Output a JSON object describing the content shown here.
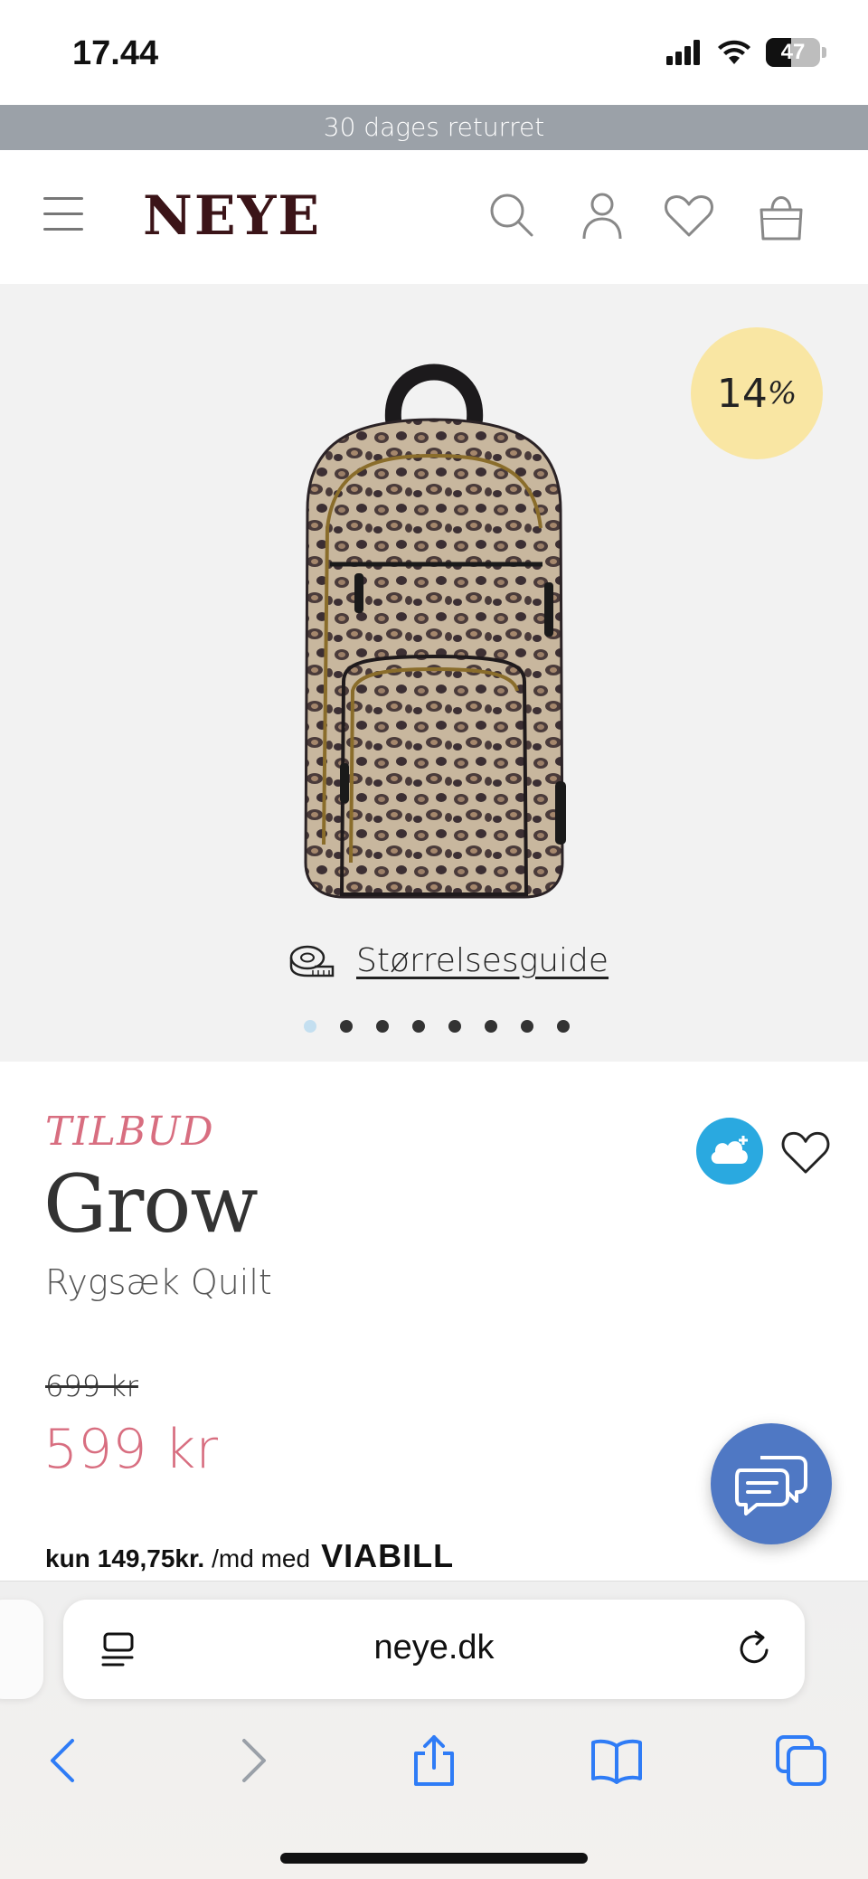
{
  "status_bar": {
    "time": "17.44",
    "battery_level": "47",
    "battery_fraction": 0.47
  },
  "promo": {
    "text": "30 dages returret"
  },
  "header": {
    "logo": "NEYE",
    "icons": [
      "menu-icon",
      "search-icon",
      "user-icon",
      "heart-icon",
      "shopping-bag-icon"
    ]
  },
  "gallery": {
    "discount": "14",
    "discount_symbol": "%",
    "size_guide_label": "Størrelsesguide",
    "dot_count": 8,
    "active_dot": 0
  },
  "product": {
    "tag": "TILBUD",
    "brand": "Grow",
    "name": "Rygsæk Quilt",
    "price_old": "699 kr",
    "price_new": "599 kr",
    "installment_prefix": "kun",
    "installment_amount": "149,75kr.",
    "installment_suffix": "/md med",
    "installment_provider": "VIABILL"
  },
  "browser": {
    "url": "neye.dk"
  },
  "colors": {
    "accent_pink": "#d86e80",
    "logo_color": "#3b1418",
    "promo_bg": "#9ba1a8",
    "badge_bg": "#f9e6a3",
    "chat_fab": "#4f78c4",
    "cloud_btn": "#2aa9e0",
    "ios_blue": "#2f7cf6"
  }
}
